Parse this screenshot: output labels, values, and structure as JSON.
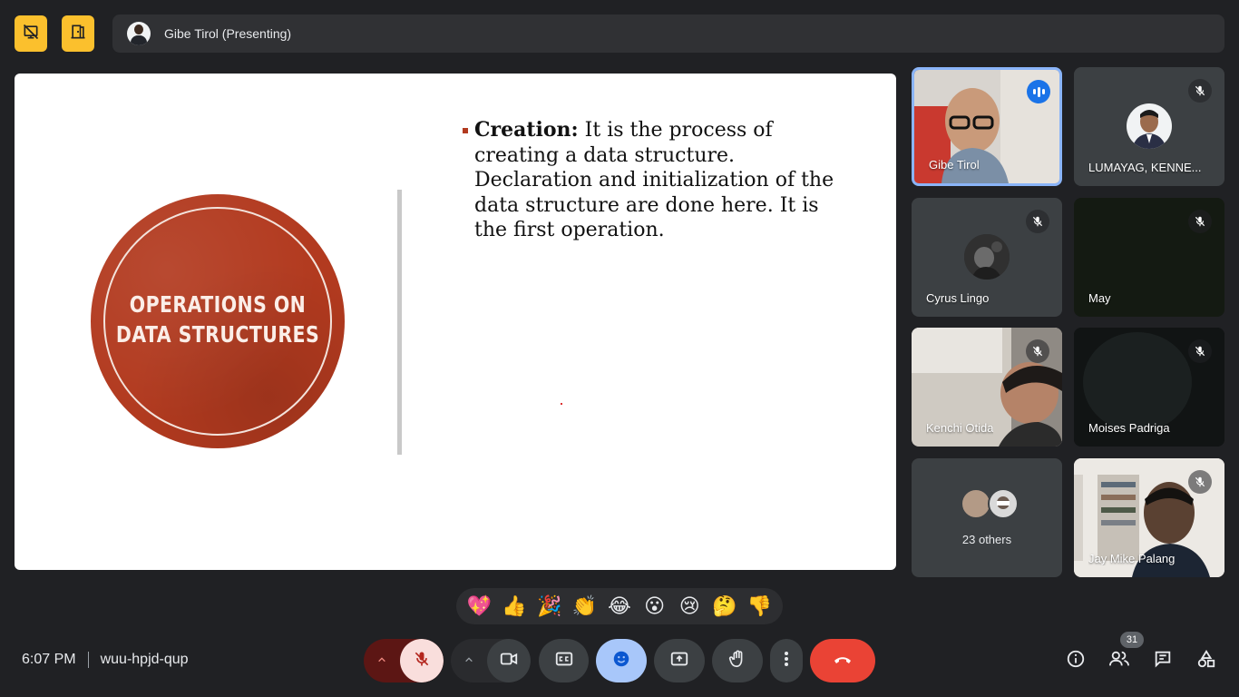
{
  "presenter_bar": {
    "name": "Gibe Tirol (Presenting)"
  },
  "slide": {
    "circle_title_line1": "OPERATIONS ON",
    "circle_title_line2": "DATA STRUCTURES",
    "bullet_term": "Creation:",
    "bullet_text": " It is the process of creating a data structure. Declaration and initialization of the data structure are done here. It is the first operation."
  },
  "participants": [
    {
      "name": "Gibe Tirol",
      "status": "speaking"
    },
    {
      "name": "LUMAYAG, KENNE...",
      "status": "muted"
    },
    {
      "name": "Cyrus Lingo",
      "status": "muted"
    },
    {
      "name": "May",
      "status": "muted"
    },
    {
      "name": "Kenchi Otida",
      "status": "muted"
    },
    {
      "name": "Moises Padriga",
      "status": "muted"
    },
    {
      "name": "23 others",
      "status": "group"
    },
    {
      "name": "Jay Mike Palang",
      "status": "muted"
    }
  ],
  "reactions": [
    "💖",
    "👍",
    "🎉",
    "👏",
    "😂",
    "😮",
    "😢",
    "🤔",
    "👎"
  ],
  "footer": {
    "time": "6:07 PM",
    "meeting_code": "wuu-hpjd-qup",
    "participant_count": "31"
  },
  "colors": {
    "background": "#202124",
    "accent_yellow": "#fbc02d",
    "active_blue": "#8ab4f8",
    "end_call_red": "#ea4335",
    "slide_red": "#b23a1f"
  }
}
